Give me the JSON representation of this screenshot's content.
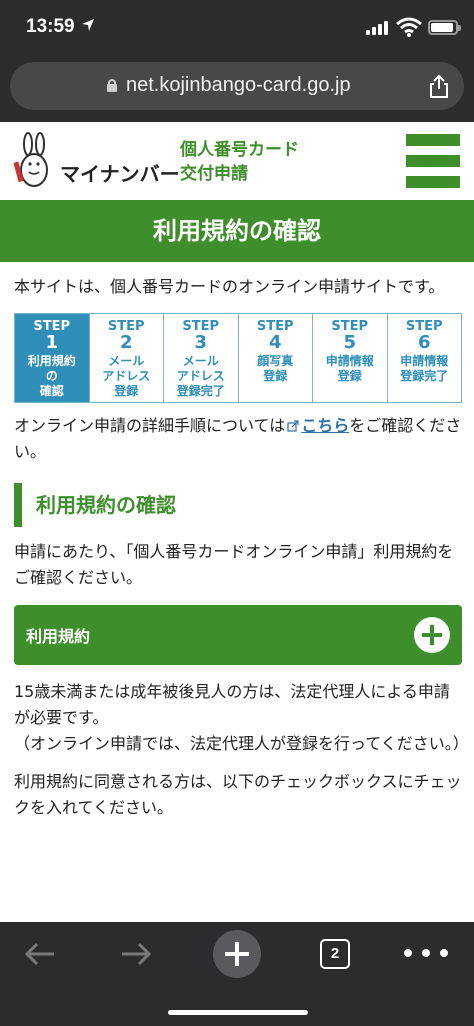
{
  "status_bar": {
    "time": "13:59"
  },
  "browser": {
    "url": "net.kojinbango-card.go.jp",
    "tab_count": "2"
  },
  "header": {
    "brand": "マイナンバー",
    "title_line1": "個人番号カード",
    "title_line2": "交付申請"
  },
  "banner": {
    "title": "利用規約の確認"
  },
  "intro": "本サイトは、個人番号カードのオンライン申請サイトです。",
  "steps": [
    {
      "label": "STEP",
      "num": "1",
      "name_l1": "利用規約",
      "name_l2": "の",
      "name_l3": "確認",
      "active": true
    },
    {
      "label": "STEP",
      "num": "2",
      "name_l1": "メール",
      "name_l2": "アドレス",
      "name_l3": "登録",
      "active": false
    },
    {
      "label": "STEP",
      "num": "3",
      "name_l1": "メール",
      "name_l2": "アドレス",
      "name_l3": "登録完了",
      "active": false
    },
    {
      "label": "STEP",
      "num": "4",
      "name_l1": "顔写真",
      "name_l2": "登録",
      "name_l3": "",
      "active": false
    },
    {
      "label": "STEP",
      "num": "5",
      "name_l1": "申請情報",
      "name_l2": "登録",
      "name_l3": "",
      "active": false
    },
    {
      "label": "STEP",
      "num": "6",
      "name_l1": "申請情報",
      "name_l2": "登録完了",
      "name_l3": "",
      "active": false
    }
  ],
  "detail": {
    "before": "オンライン申請の詳細手順については",
    "link": "こちら",
    "after": "をご確認ください。"
  },
  "section_heading": "利用規約の確認",
  "p2": "申請にあたり、「個人番号カードオンライン申請」利用規約をご確認ください。",
  "accordion": {
    "label": "利用規約"
  },
  "p3": "15歳未満または成年被後見人の方は、法定代理人による申請が必要です。",
  "p4": "（オンライン申請では、法定代理人が登録を行ってください。）",
  "p5": "利用規約に同意される方は、以下のチェックボックスにチェックを入れてください。",
  "colors": {
    "brand_green": "#3e8e2c",
    "step_blue": "#2f8fb8",
    "chrome": "#2c2c2e"
  }
}
